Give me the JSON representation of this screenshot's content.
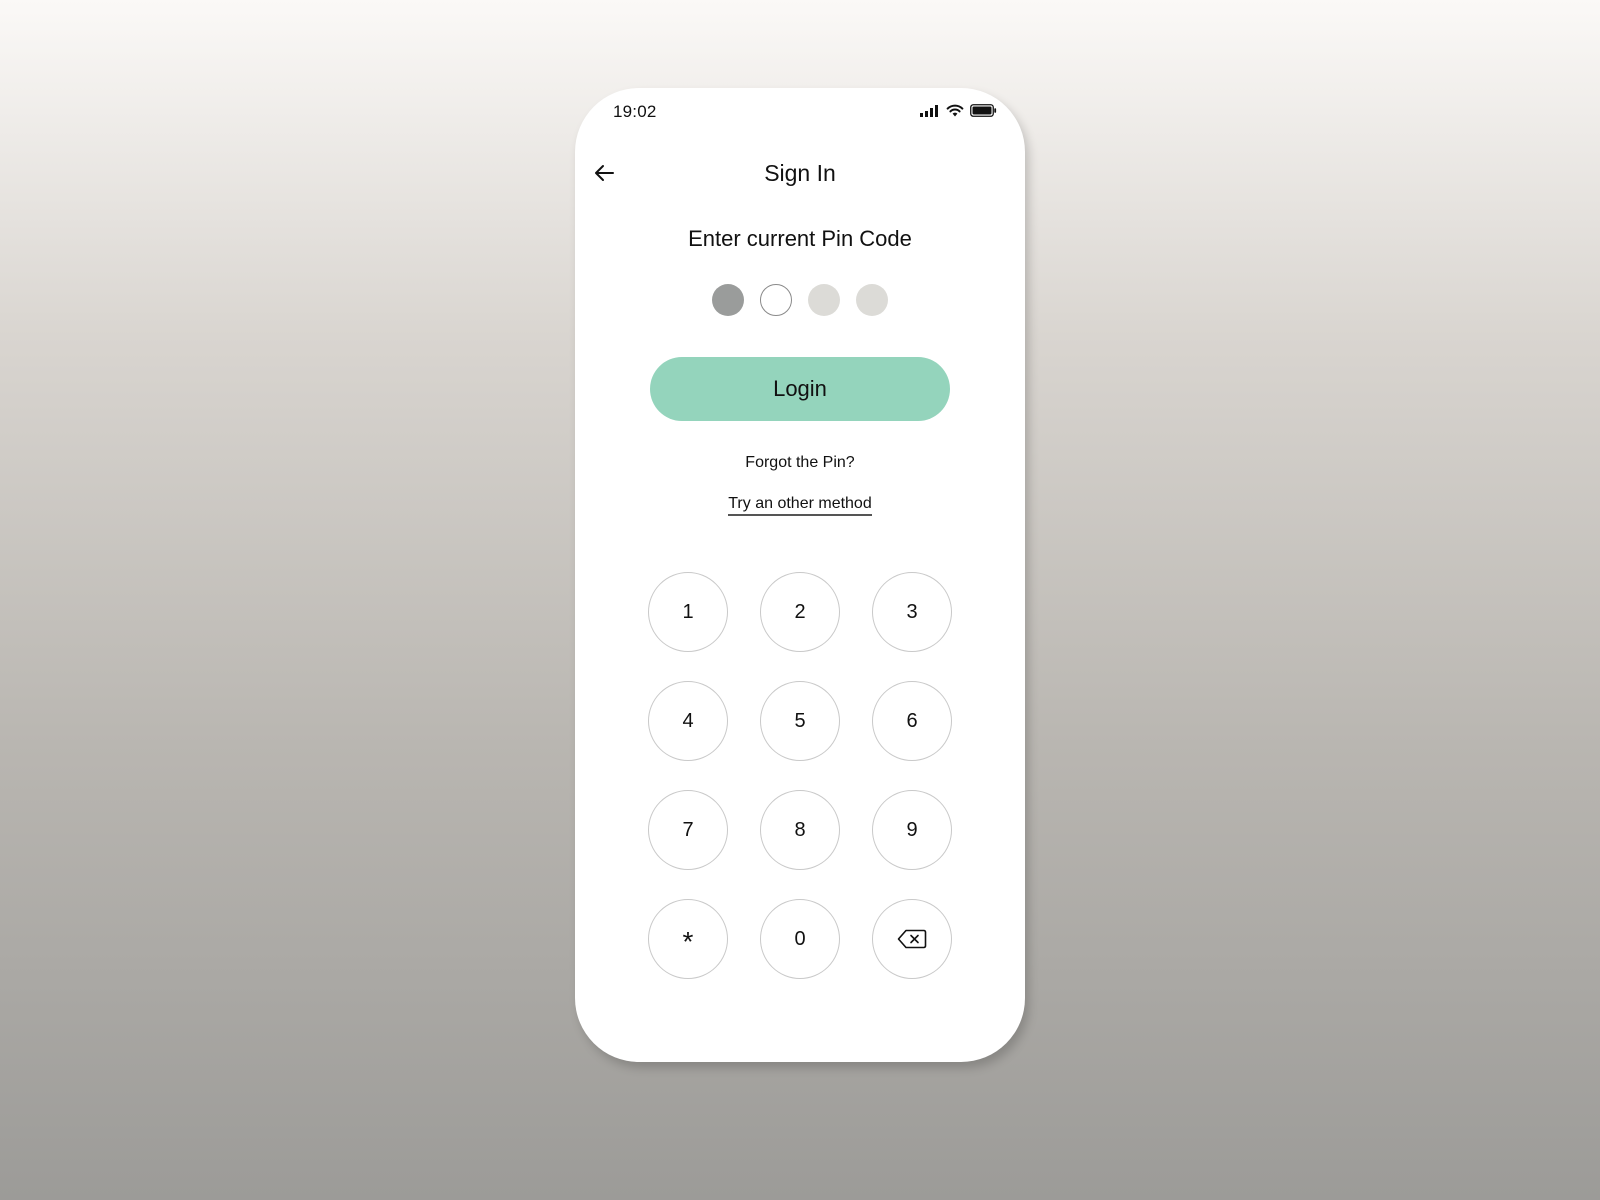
{
  "status_bar": {
    "time": "19:02",
    "icons": [
      "signal-icon",
      "wifi-icon",
      "battery-icon"
    ]
  },
  "header": {
    "back_icon": "arrow-left-icon",
    "title": "Sign In"
  },
  "pin": {
    "prompt": "Enter current Pin Code",
    "length": 4,
    "entered": 1,
    "dots": [
      "filled",
      "active",
      "empty",
      "empty"
    ]
  },
  "actions": {
    "login_label": "Login",
    "forgot_text": "Forgot the Pin?",
    "other_method_label": "Try an other method"
  },
  "keypad": {
    "keys": [
      "1",
      "2",
      "3",
      "4",
      "5",
      "6",
      "7",
      "8",
      "9",
      "*",
      "0"
    ],
    "backspace_icon": "backspace-icon"
  },
  "colors": {
    "accent": "#94d4bc",
    "dot_filled": "#9a9c9b",
    "dot_empty": "#dcdbd7",
    "key_border": "#c9c9c9"
  }
}
